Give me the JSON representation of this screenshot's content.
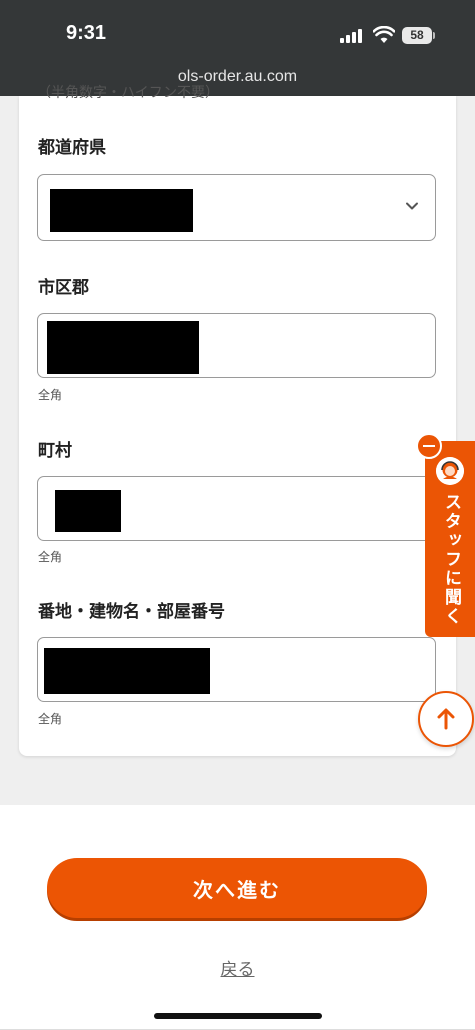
{
  "status_bar": {
    "time": "9:31",
    "battery": "58",
    "url": "ols-order.au.com"
  },
  "form": {
    "cutoff_text": "（半角数字・ハイフン不要）",
    "prefecture": {
      "label": "都道府県"
    },
    "city": {
      "label": "市区郡",
      "hint": "全角"
    },
    "town": {
      "label": "町村",
      "hint": "全角"
    },
    "address": {
      "label": "番地・建物名・部屋番号",
      "hint": "全角"
    }
  },
  "staff_tab": {
    "label": "スタッフに聞く"
  },
  "actions": {
    "next": "次へ進む",
    "back": "戻る"
  },
  "colors": {
    "accent": "#EC5504",
    "statusbar": "#343738",
    "background": "#EFEFEF"
  },
  "icons": [
    "signal-icon",
    "wifi-icon",
    "battery-icon",
    "chevron-down-icon",
    "minus-icon",
    "staff-avatar-icon",
    "arrow-up-icon"
  ]
}
